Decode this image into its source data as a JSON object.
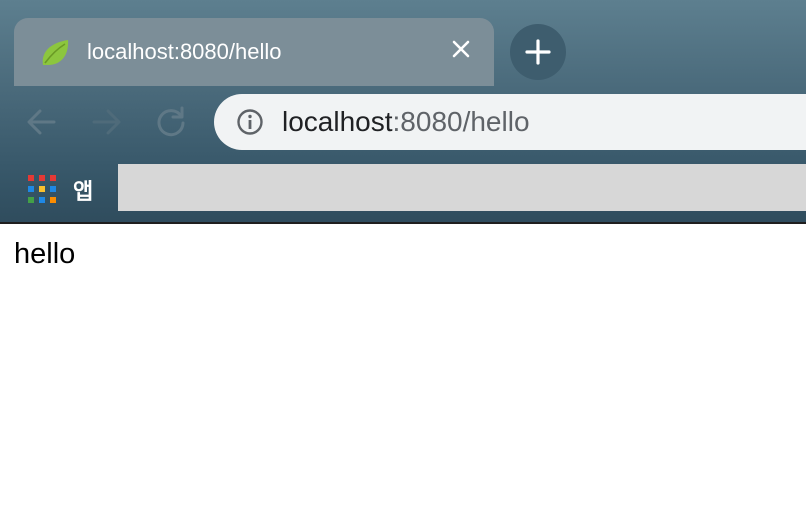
{
  "tab": {
    "title": "localhost:8080/hello",
    "favicon": "spring-leaf-icon",
    "close_icon": "close-icon"
  },
  "toolbar": {
    "new_tab_icon": "plus-icon",
    "back_icon": "back-arrow-icon",
    "forward_icon": "forward-arrow-icon",
    "reload_icon": "reload-icon"
  },
  "omnibox": {
    "info_icon": "info-icon",
    "host": "localhost",
    "path": ":8080/hello"
  },
  "bookmarks": {
    "apps_label": "앱",
    "apps_icon": "apps-grid-icon"
  },
  "page": {
    "body_text": "hello"
  },
  "colors": {
    "tab_active": "#7c8e98",
    "omnibox_bg": "#f1f3f4",
    "bookmarks_bar_bg": "#d7d7d7",
    "spring_green": "#8cc63e"
  }
}
